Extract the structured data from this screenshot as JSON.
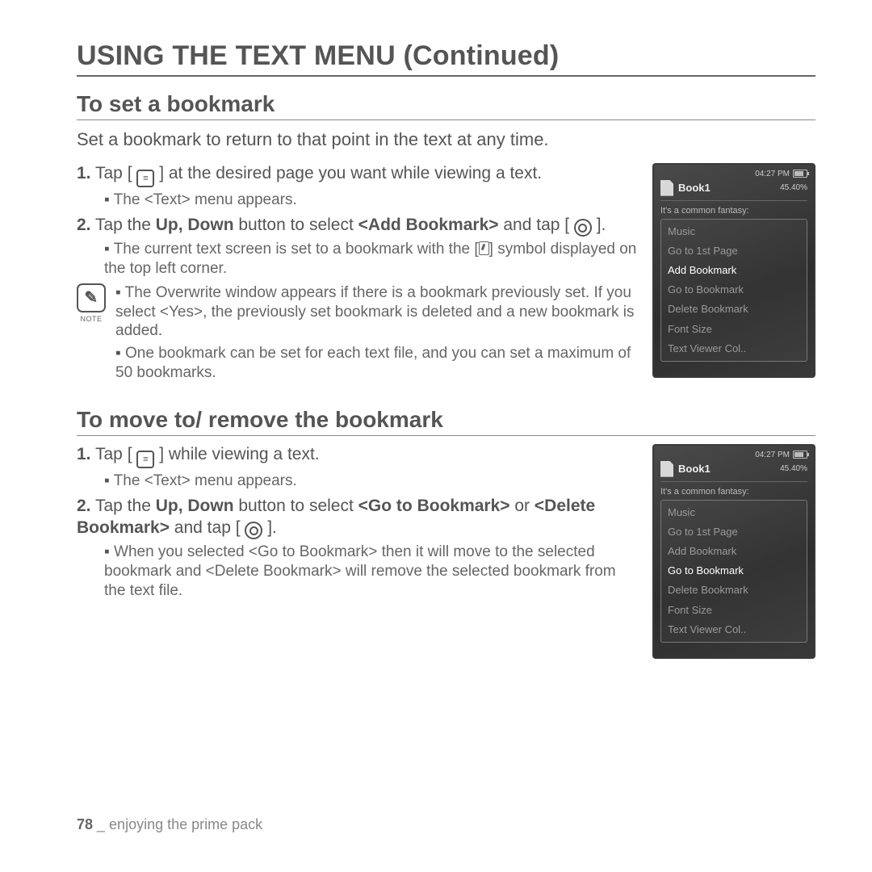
{
  "heading": "USING THE TEXT MENU (Continued)",
  "section1": {
    "title": "To set a bookmark",
    "intro": "Set a bookmark to return to that point in the text at any time.",
    "step1a": "Tap ",
    "step1b": " at the desired page you want while viewing a text.",
    "step1_sub": "The <Text> menu appears.",
    "step2a": "Tap the ",
    "step2b": "Up, Down ",
    "step2c": " button to select ",
    "step2d": "<Add Bookmark>",
    "step2e": " and tap ",
    "step2_sub": "The current text screen is set to a bookmark with the [",
    "step2_sub_end": "] symbol displayed on the top left corner.",
    "note_label": "NOTE",
    "note1": "The Overwrite window appears if there is a bookmark previously set. If you select <Yes>, the previously set bookmark is deleted and a new bookmark is added.",
    "note2": "One bookmark can be set for each text file, and you can set a maximum of 50 bookmarks."
  },
  "section2": {
    "title": "To move to/ remove the bookmark",
    "step1a": "Tap ",
    "step1b": " while viewing a text.",
    "step1_sub": "The <Text> menu appears.",
    "step2a": "Tap the ",
    "step2b": "Up, Down",
    "step2c": " button to select ",
    "step2d": "<Go to Bookmark>",
    "step2e": " or ",
    "step2f": "<Delete Bookmark>",
    "step2g": " and tap ",
    "step2_sub": "When you selected <Go to Bookmark> then it will move to the selected bookmark and <Delete Bookmark> will remove the selected bookmark from the text file."
  },
  "device": {
    "time": "04:27 PM",
    "book": "Book1",
    "pct": "45.40%",
    "fantasy": "It's a common fantasy:",
    "menu": [
      "Music",
      "Go to 1st Page",
      "Add Bookmark",
      "Go to Bookmark",
      "Delete Bookmark",
      "Font Size",
      "Text Viewer Col.."
    ],
    "sel1": 2,
    "sel2": 3
  },
  "footer": {
    "page": "78",
    "sep": " _ ",
    "text": "enjoying the prime pack"
  }
}
